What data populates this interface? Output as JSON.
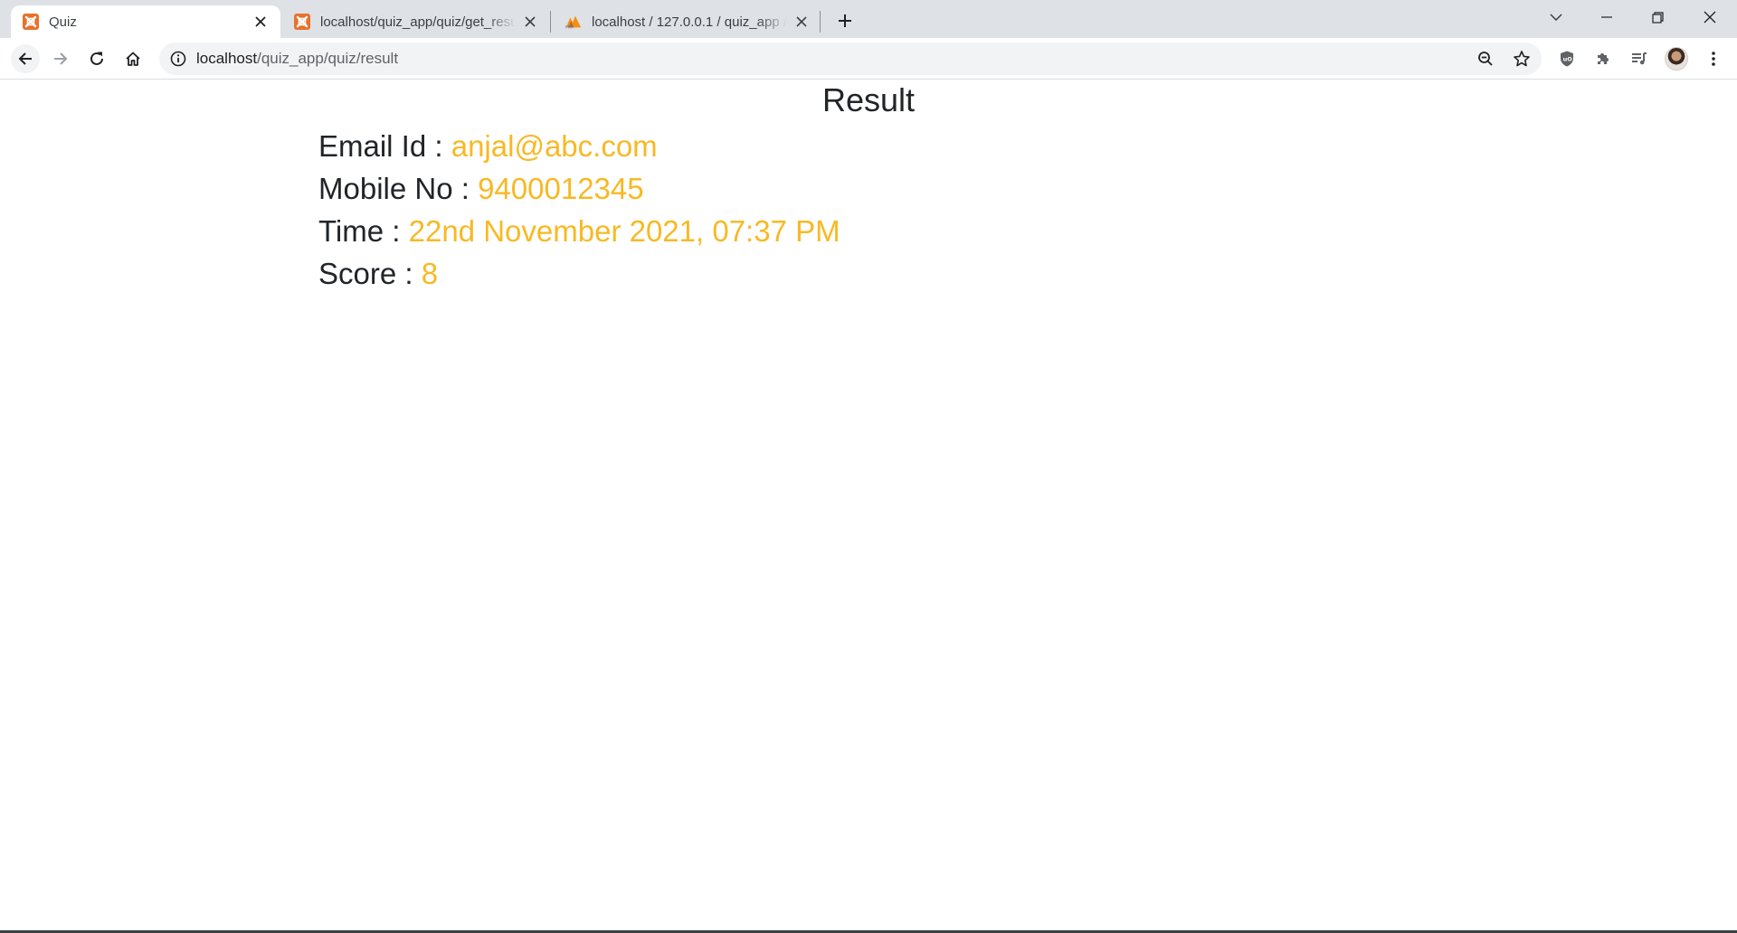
{
  "browser": {
    "tabs": [
      {
        "title": "Quiz",
        "icon": "xampp-icon",
        "active": true
      },
      {
        "title": "localhost/quiz_app/quiz/get_resu",
        "icon": "xampp-icon",
        "active": false
      },
      {
        "title": "localhost / 127.0.0.1 / quiz_app /",
        "icon": "phpmyadmin-icon",
        "active": false
      }
    ],
    "address_bar": {
      "host": "localhost",
      "path": "/quiz_app/quiz/result"
    },
    "accent_color": "#e8712b"
  },
  "page": {
    "heading": "Result",
    "fields": [
      {
        "label": "Email Id : ",
        "value": "anjal@abc.com"
      },
      {
        "label": "Mobile No : ",
        "value": "9400012345"
      },
      {
        "label": "Time : ",
        "value": "22nd November 2021, 07:37 PM"
      },
      {
        "label": "Score : ",
        "value": "8"
      }
    ],
    "value_color": "#f7b924"
  }
}
